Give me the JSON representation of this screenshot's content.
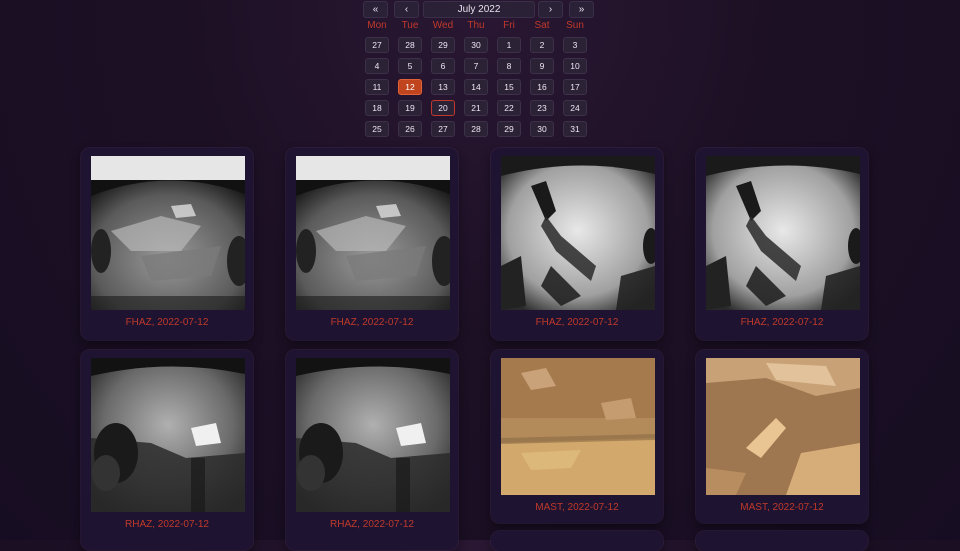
{
  "calendar": {
    "prev_year": "«",
    "prev_month": "‹",
    "month_label": "July 2022",
    "next_month": "›",
    "next_year": "»",
    "weekdays": [
      "Mon",
      "Tue",
      "Wed",
      "Thu",
      "Fri",
      "Sat",
      "Sun"
    ],
    "weeks": [
      [
        "27",
        "28",
        "29",
        "30",
        "1",
        "2",
        "3"
      ],
      [
        "4",
        "5",
        "6",
        "7",
        "8",
        "9",
        "10"
      ],
      [
        "11",
        "12",
        "13",
        "14",
        "15",
        "16",
        "17"
      ],
      [
        "18",
        "19",
        "20",
        "21",
        "22",
        "23",
        "24"
      ],
      [
        "25",
        "26",
        "27",
        "28",
        "29",
        "30",
        "31"
      ]
    ],
    "selected_day": "12",
    "highlighted_day": "20"
  },
  "photos": [
    {
      "caption": "FHAZ, 2022-07-12",
      "kind": "fhaz-rock"
    },
    {
      "caption": "FHAZ, 2022-07-12",
      "kind": "fhaz-rock"
    },
    {
      "caption": "FHAZ, 2022-07-12",
      "kind": "fhaz-arm"
    },
    {
      "caption": "FHAZ, 2022-07-12",
      "kind": "fhaz-arm"
    },
    {
      "caption": "RHAZ, 2022-07-12",
      "kind": "rhaz"
    },
    {
      "caption": "RHAZ, 2022-07-12",
      "kind": "rhaz"
    },
    {
      "caption": "MAST, 2022-07-12",
      "kind": "mast-1"
    },
    {
      "caption": "MAST, 2022-07-12",
      "kind": "mast-2"
    }
  ],
  "colors": {
    "accent": "#c0392b",
    "selected": "#c0441e",
    "card": "#1e1330"
  }
}
